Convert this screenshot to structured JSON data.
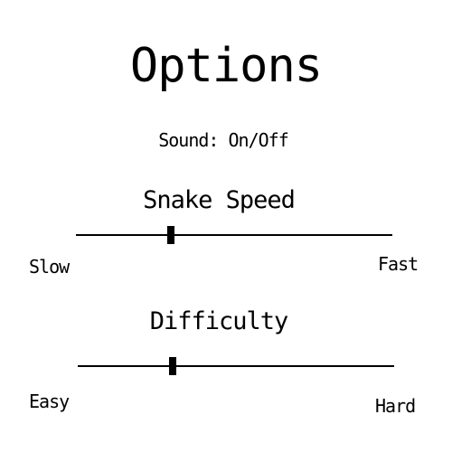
{
  "title": "Options",
  "sound": {
    "label": "Sound: On/Off"
  },
  "speed": {
    "heading": "Snake Speed",
    "min_label": "Slow",
    "max_label": "Fast",
    "level": 0.3
  },
  "difficulty": {
    "heading": "Difficulty",
    "min_label": "Easy",
    "max_label": "Hard",
    "level": 0.3
  },
  "colors": {
    "background": "#ffffff",
    "foreground": "#000000"
  }
}
